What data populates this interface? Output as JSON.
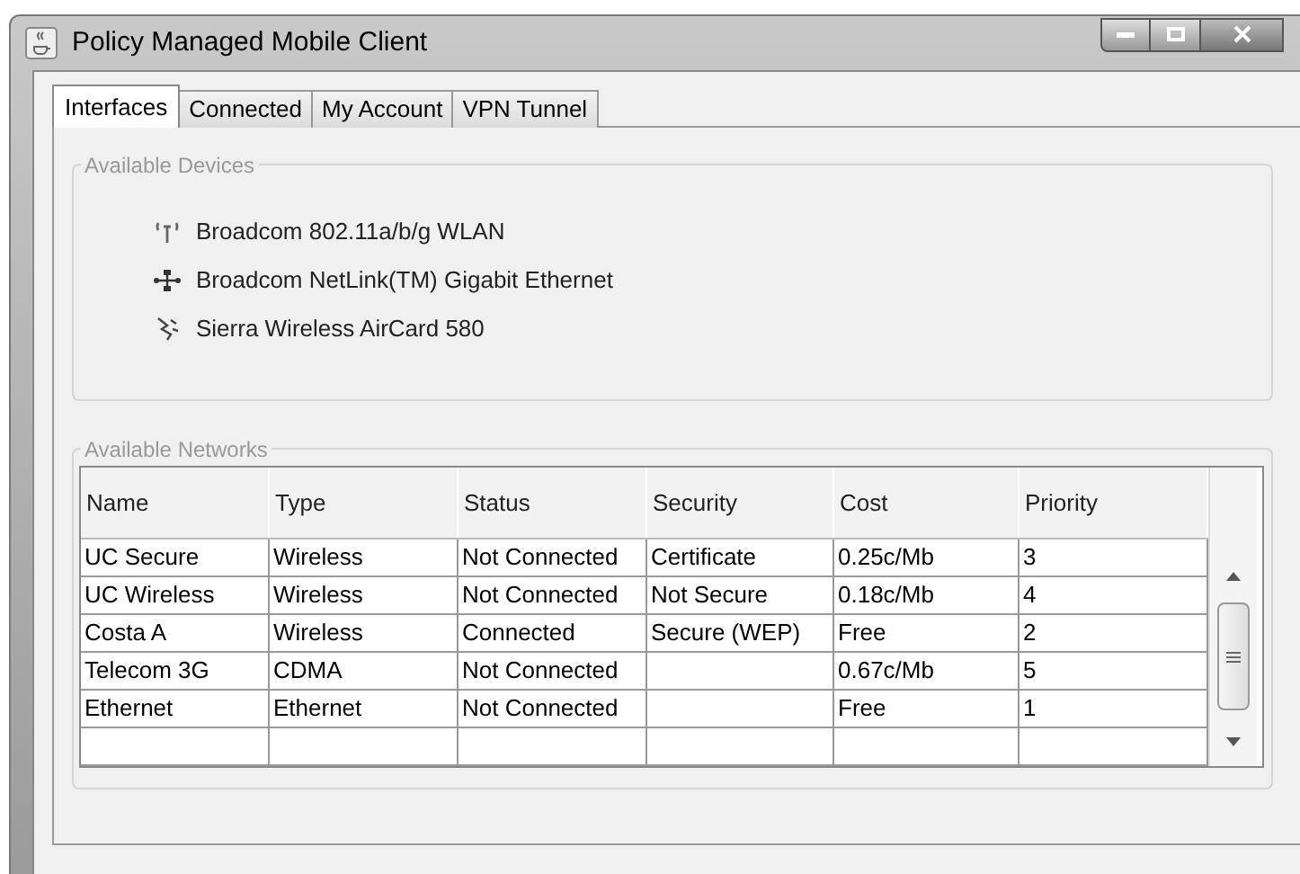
{
  "window": {
    "title": "Policy Managed Mobile Client"
  },
  "tabs": [
    {
      "label": "Interfaces",
      "selected": true
    },
    {
      "label": "Connected",
      "selected": false
    },
    {
      "label": "My Account",
      "selected": false
    },
    {
      "label": "VPN Tunnel",
      "selected": false
    }
  ],
  "devices": {
    "title": "Available Devices",
    "items": [
      {
        "kind": "wireless",
        "name": "Broadcom 802.11a/b/g WLAN"
      },
      {
        "kind": "ethernet",
        "name": "Broadcom NetLink(TM) Gigabit Ethernet"
      },
      {
        "kind": "cellular",
        "name": "Sierra Wireless AirCard 580"
      }
    ]
  },
  "networks": {
    "title": "Available Networks",
    "columns": [
      "Name",
      "Type",
      "Status",
      "Security",
      "Cost",
      "Priority"
    ],
    "rows": [
      [
        "UC Secure",
        "Wireless",
        "Not Connected",
        "Certificate",
        "0.25c/Mb",
        "3"
      ],
      [
        "UC Wireless",
        "Wireless",
        "Not Connected",
        "Not Secure",
        "0.18c/Mb",
        "4"
      ],
      [
        "Costa A",
        "Wireless",
        "Connected",
        "Secure (WEP)",
        "Free",
        "2"
      ],
      [
        "Telecom 3G",
        "CDMA",
        "Not Connected",
        "",
        "0.67c/Mb",
        "5"
      ],
      [
        "Ethernet",
        "Ethernet",
        "Not Connected",
        "",
        "Free",
        "1"
      ]
    ]
  }
}
